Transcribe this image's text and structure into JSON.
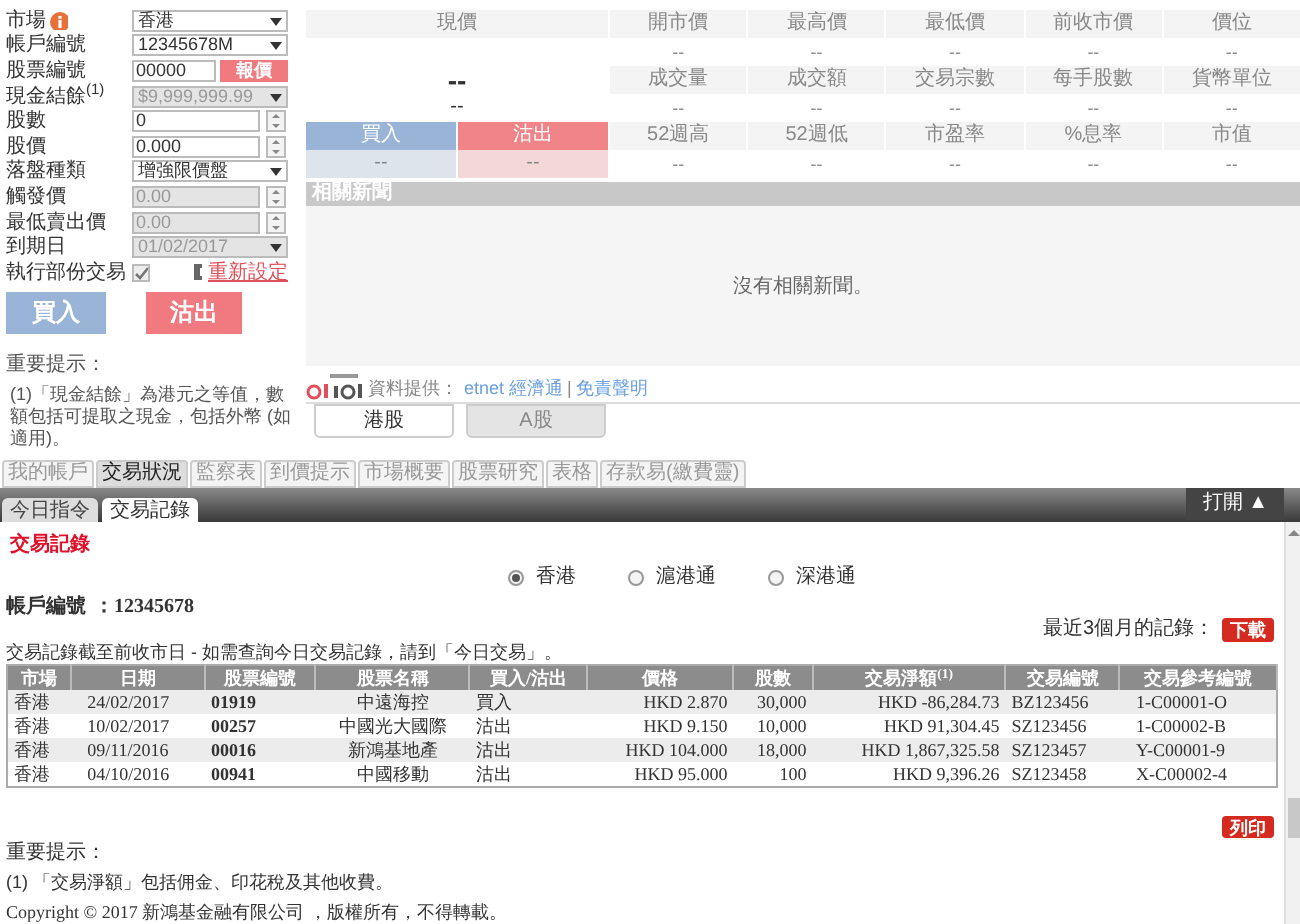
{
  "order_form": {
    "fields": [
      {
        "label": "市場",
        "kind": "select",
        "value": "香港",
        "disabled": false,
        "info": true
      },
      {
        "label": "帳戶編號",
        "kind": "select",
        "value": "12345678M",
        "disabled": false
      },
      {
        "label": "股票編號",
        "kind": "input",
        "value": "00000",
        "disabled": false,
        "button": "報價"
      },
      {
        "label": "現金結餘$^{(1)}$",
        "kind": "select",
        "value": "$9,999,999.99",
        "disabled": true
      },
      {
        "label": "股數",
        "kind": "spin",
        "value": "0",
        "disabled": false
      },
      {
        "label": "股價",
        "kind": "spin",
        "value": "0.000",
        "disabled": false
      },
      {
        "label": "落盤種類",
        "kind": "select",
        "value": "增強限價盤",
        "disabled": false
      },
      {
        "label": "觸發價",
        "kind": "spin",
        "value": "0.00",
        "disabled": true
      },
      {
        "label": "最低賣出價",
        "kind": "spin",
        "value": "0.00",
        "disabled": true
      },
      {
        "label": "到期日",
        "kind": "select",
        "value": "01/02/2017",
        "disabled": true
      },
      {
        "label": "執行部份交易",
        "kind": "checkbox",
        "checked": true,
        "disabled": true,
        "link": "重新設定"
      }
    ],
    "buttons": [
      "買入",
      "沽出"
    ],
    "notes_title": "重要提示：",
    "notes": [
      "(1)「現金結餘」為港元之等值，數額包括可提取之現金，包括外幣 (如適用)。"
    ]
  },
  "quote": {
    "price_label": "現價",
    "price": "--",
    "change": "--",
    "bid_label": "買入",
    "ask_label": "沽出",
    "bid": "--",
    "ask": "--",
    "stats": [
      {
        "label": "開市價",
        "value": "--"
      },
      {
        "label": "最高價",
        "value": "--"
      },
      {
        "label": "最低價",
        "value": "--"
      },
      {
        "label": "前收市價",
        "value": "--"
      },
      {
        "label": "價位",
        "value": "--"
      },
      {
        "label": "成交量",
        "value": "--"
      },
      {
        "label": "成交額",
        "value": "--"
      },
      {
        "label": "交易宗數",
        "value": "--"
      },
      {
        "label": "每手股數",
        "value": "--"
      },
      {
        "label": "貨幣單位",
        "value": "--"
      },
      {
        "label": "52週高",
        "value": "--"
      },
      {
        "label": "52週低",
        "value": "--"
      },
      {
        "label": "市盈率",
        "value": "--"
      },
      {
        "label": "%息率",
        "value": "--"
      },
      {
        "label": "市值",
        "value": "--"
      }
    ],
    "news_title": "相關新聞",
    "news_empty": "沒有相關新聞。",
    "source_label": "資料提供：",
    "source_links": [
      "etnet 經濟通",
      "免責聲明"
    ],
    "source_separator": "|",
    "market_tabs": [
      {
        "label": "港股",
        "selected": true
      },
      {
        "label": "A股",
        "selected": false
      }
    ]
  },
  "main_tabs": [
    {
      "label": "我的帳戶",
      "selected": false
    },
    {
      "label": "交易狀況",
      "selected": true
    },
    {
      "label": "監察表",
      "selected": false
    },
    {
      "label": "到價提示",
      "selected": false
    },
    {
      "label": "市場概要",
      "selected": false
    },
    {
      "label": "股票研究",
      "selected": false
    },
    {
      "label": "表格",
      "selected": false
    },
    {
      "label": "存款易(繳費靈)",
      "selected": false
    }
  ],
  "sub_tabs": [
    {
      "label": "今日指令",
      "selected": false
    },
    {
      "label": "交易記錄",
      "selected": true
    }
  ],
  "panel_toggle": "打開 ▲",
  "records": {
    "title": "交易記錄",
    "markets": [
      {
        "label": "香港",
        "selected": true
      },
      {
        "label": "滬港通",
        "selected": false
      },
      {
        "label": "深港通",
        "selected": false
      }
    ],
    "account_label": "帳戶編號",
    "account": "：12345678",
    "download_label": "最近3個月的記錄：",
    "download": "下載",
    "notice": "交易記錄截至前收市日 - 如需查詢今日交易記錄，請到「今日交易」。",
    "columns": [
      "市場",
      "日期",
      "股票編號",
      "股票名稱",
      "買入/沽出",
      "價格",
      "股數",
      "交易淨額$^{(1)}$",
      "交易編號",
      "交易參考編號"
    ],
    "rows": [
      [
        "香港",
        "24/02/2017",
        "01919",
        "中遠海控",
        "買入",
        "HKD 2.870",
        "30,000",
        "HKD -86,284.73",
        "BZ123456",
        "1-C00001-O"
      ],
      [
        "香港",
        "10/02/2017",
        "00257",
        "中國光大國際",
        "沽出",
        "HKD 9.150",
        "10,000",
        "HKD 91,304.45",
        "SZ123456",
        "1-C00002-B"
      ],
      [
        "香港",
        "09/11/2016",
        "00016",
        "新鴻基地產",
        "沽出",
        "HKD 104.000",
        "18,000",
        "HKD 1,867,325.58",
        "SZ123457",
        "Y-C00001-9"
      ],
      [
        "香港",
        "04/10/2016",
        "00941",
        "中國移動",
        "沽出",
        "HKD 95.000",
        "100",
        "HKD 9,396.26",
        "SZ123458",
        "X-C00002-4"
      ]
    ],
    "print": "列印",
    "notes_title": "重要提示：",
    "notes": [
      "(1) 「交易淨額」包括佣金、印花稅及其他收費。"
    ],
    "copyright": "Copyright © 2017 新鴻基金融有限公司 ，版權所有，不得轉載。"
  }
}
